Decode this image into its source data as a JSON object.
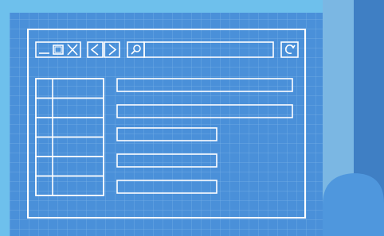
{
  "colors": {
    "outer_background": "#6ec0ec",
    "sheet_blue": "#4a90d9",
    "sheet_edge_dark": "#3f7fc4",
    "sheet_strip_light": "#7bb7e3",
    "grid_line": "#8fc4ef",
    "stroke": "#ffffff"
  },
  "illustration": {
    "style": "blueprint-browser-wireframe",
    "window_controls": [
      "minimize-icon",
      "maximize-icon",
      "close-icon"
    ],
    "nav_controls": [
      "back-icon",
      "forward-icon"
    ],
    "search_icon": "search-icon",
    "refresh_icon": "refresh-icon",
    "sidebar_rows": 6,
    "content_bars": [
      {
        "length_fraction": 1.0
      },
      {
        "length_fraction": 1.0
      },
      {
        "length_fraction": 0.57
      },
      {
        "length_fraction": 0.57
      },
      {
        "length_fraction": 0.57
      }
    ]
  }
}
